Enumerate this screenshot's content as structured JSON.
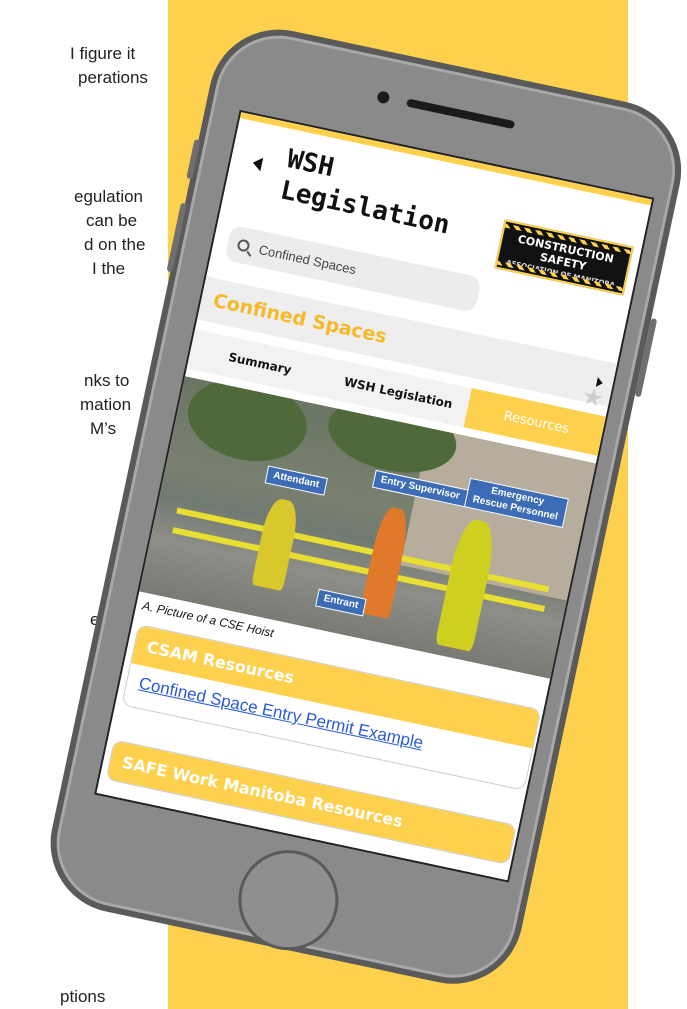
{
  "left_text": {
    "lines": [
      "I figure it",
      "perations",
      "egulation",
      "can be",
      "d on the",
      "I the",
      "nks to",
      "mation",
      "M’s",
      "e",
      "ptions"
    ]
  },
  "phone": {
    "title": "WSH\nLegislation",
    "logo": {
      "line1": "CONSTRUCTION SAFETY",
      "line2": "ASSOCIATION OF MANITOBA"
    },
    "search": {
      "value": "Confined Spaces"
    },
    "topic": {
      "label": "Confined Spaces"
    },
    "tabs": [
      {
        "label": "Summary",
        "active": false
      },
      {
        "label": "WSH Legislation",
        "active": false
      },
      {
        "label": "Resources",
        "active": true
      }
    ],
    "picture": {
      "labels": {
        "attendant": "Attendant",
        "entry_supervisor": "Entry Supervisor",
        "emergency": "Emergency\nRescue Personnel",
        "entrant": "Entrant"
      },
      "caption": "A. Picture of a CSE Hoist"
    },
    "sections": [
      {
        "title": "CSAM Resources",
        "link": "Confined Space Entry Permit Example"
      },
      {
        "title": "SAFE Work Manitoba Resources"
      }
    ]
  },
  "colors": {
    "accent": "#fdd14d",
    "link": "#2a5bd7",
    "phone_frame": "#8a8a8a"
  }
}
